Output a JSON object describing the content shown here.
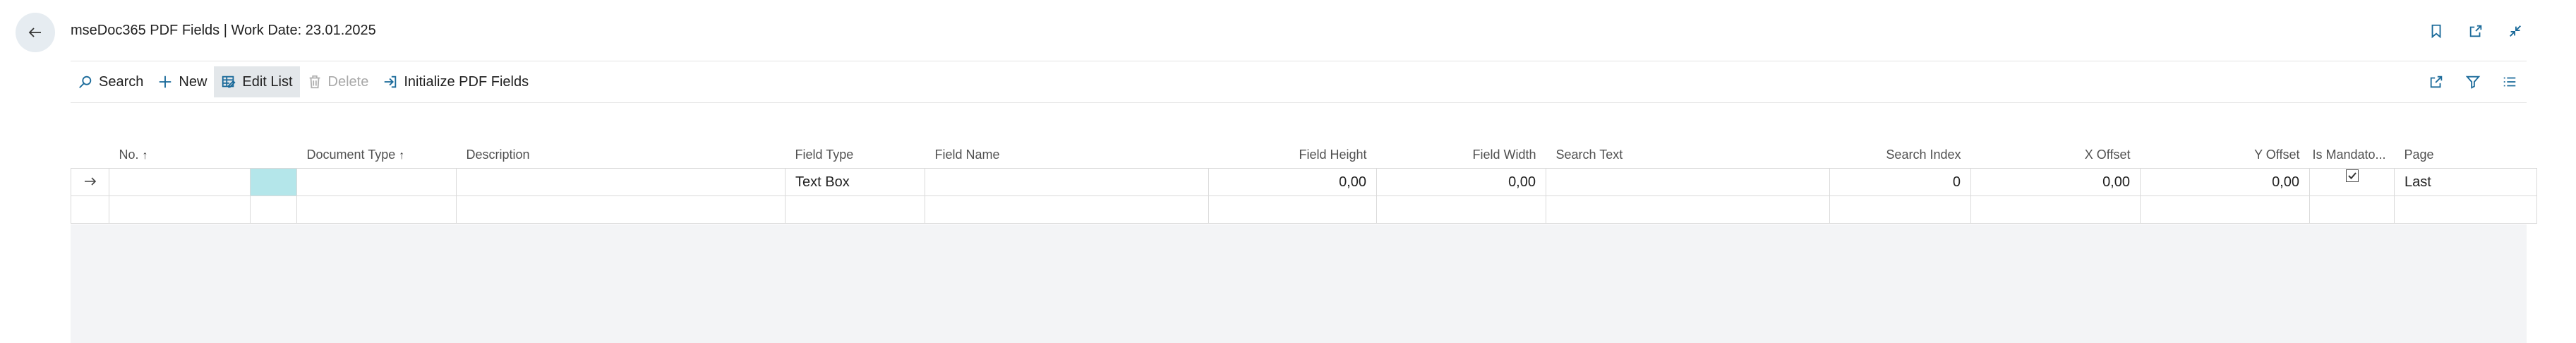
{
  "header": {
    "title": "mseDoc365 PDF Fields | Work Date: 23.01.2025",
    "icons": [
      "bookmark-icon",
      "open-new-window-icon",
      "collapse-icon"
    ]
  },
  "actions": [
    {
      "label": "Search",
      "icon": "search-icon"
    },
    {
      "label": "New",
      "icon": "plus-icon"
    },
    {
      "label": "Edit List",
      "icon": "edit-list-icon",
      "active": true
    },
    {
      "label": "Delete",
      "icon": "trash-icon",
      "disabled": true
    },
    {
      "label": "Initialize PDF Fields",
      "icon": "initialize-icon"
    }
  ],
  "bar_right_icons": [
    "share-icon",
    "filter-icon",
    "list-view-icon"
  ],
  "grid": {
    "columns": {
      "no": "No.",
      "document_type": "Document Type",
      "description": "Description",
      "field_type": "Field Type",
      "field_name": "Field Name",
      "field_height": "Field Height",
      "field_width": "Field Width",
      "search_text": "Search Text",
      "search_index": "Search Index",
      "x_offset": "X Offset",
      "y_offset": "Y Offset",
      "is_mandatory": "Is Mandato...",
      "page": "Page"
    },
    "sort_indicator": "↑",
    "rows": [
      {
        "no": "",
        "document_type": "",
        "description": "",
        "field_type": "Text Box",
        "field_name": "",
        "field_height": "0,00",
        "field_width": "0,00",
        "search_text": "",
        "search_index": "0",
        "x_offset": "0,00",
        "y_offset": "0,00",
        "is_mandatory": true,
        "page": "Last"
      }
    ]
  },
  "colors": {
    "accent": "#1a6a9a",
    "selected_cell": "#b4e6ea",
    "empty_area": "#f3f4f6"
  }
}
